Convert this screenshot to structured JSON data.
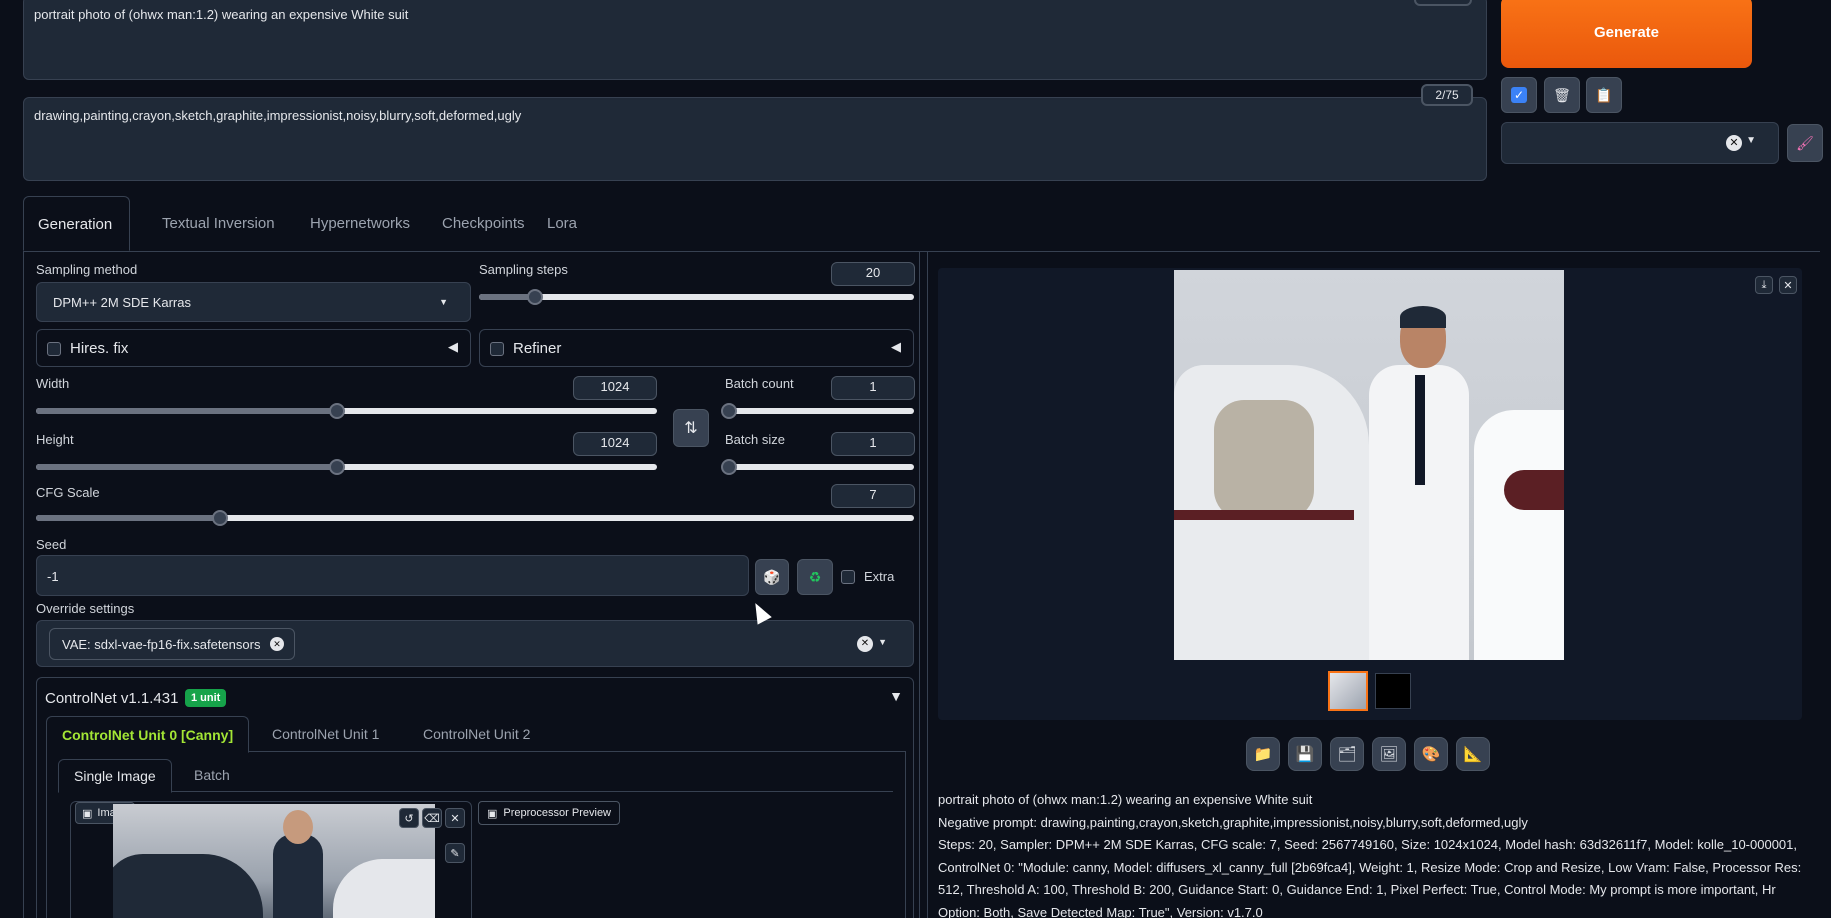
{
  "prompt": {
    "positive": "portrait photo of (ohwx man:1.2) wearing an expensive White suit",
    "negative": "drawing,painting,crayon,sketch,graphite,impressionist,noisy,blurry,soft,deformed,ugly",
    "negative_counter": "2/75"
  },
  "generate": {
    "label": "Generate"
  },
  "tabs": [
    {
      "label": "Generation"
    },
    {
      "label": "Textual Inversion"
    },
    {
      "label": "Hypernetworks"
    },
    {
      "label": "Checkpoints"
    },
    {
      "label": "Lora"
    }
  ],
  "settings": {
    "sampling_method_label": "Sampling method",
    "sampling_method_value": "DPM++ 2M SDE Karras",
    "sampling_steps_label": "Sampling steps",
    "sampling_steps_value": "20",
    "sampling_steps_fraction": 0.128,
    "hires_label": "Hires. fix",
    "refiner_label": "Refiner",
    "width_label": "Width",
    "width_value": "1024",
    "width_fraction": 0.484,
    "height_label": "Height",
    "height_value": "1024",
    "height_fraction": 0.484,
    "batch_count_label": "Batch count",
    "batch_count_value": "1",
    "batch_size_label": "Batch size",
    "batch_size_value": "1",
    "cfg_label": "CFG Scale",
    "cfg_value": "7",
    "cfg_fraction": 0.21,
    "seed_label": "Seed",
    "seed_value": "-1",
    "extra_label": "Extra",
    "override_label": "Override settings",
    "override_chip": "VAE: sdxl-vae-fp16-fix.safetensors"
  },
  "controlnet": {
    "title": "ControlNet v1.1.431",
    "badge": "1 unit",
    "units": [
      {
        "label": "ControlNet Unit 0 [Canny]"
      },
      {
        "label": "ControlNet Unit 1"
      },
      {
        "label": "ControlNet Unit 2"
      }
    ],
    "mode_tabs": [
      {
        "label": "Single Image"
      },
      {
        "label": "Batch"
      }
    ],
    "image_label": "Image",
    "preprocessor_label": "Preprocessor Preview"
  },
  "output": {
    "info_prompt": "portrait photo of (ohwx man:1.2) wearing an expensive White suit",
    "info_negative": "Negative prompt: drawing,painting,crayon,sketch,graphite,impressionist,noisy,blurry,soft,deformed,ugly",
    "info_params_1": "Steps: 20, Sampler: DPM++ 2M SDE Karras, CFG scale: 7, Seed: 2567749160, Size: 1024x1024, Model hash: 63d32611f7, Model: kolle_10-000001,",
    "info_params_2": "ControlNet 0: \"Module: canny, Model: diffusers_xl_canny_full [2b69fca4], Weight: 1, Resize Mode: Crop and Resize, Low Vram: False, Processor Res:",
    "info_params_3": "512, Threshold A: 100, Threshold B: 200, Guidance Start: 0, Guidance End: 1, Pixel Perfect: True, Control Mode: My prompt is more important, Hr",
    "info_params_4": "Option: Both, Save Detected Map: True\", Version: v1.7.0"
  },
  "colors": {
    "accent": "#f97316",
    "active_unit": "#a3e635",
    "badge": "#16a34a"
  }
}
